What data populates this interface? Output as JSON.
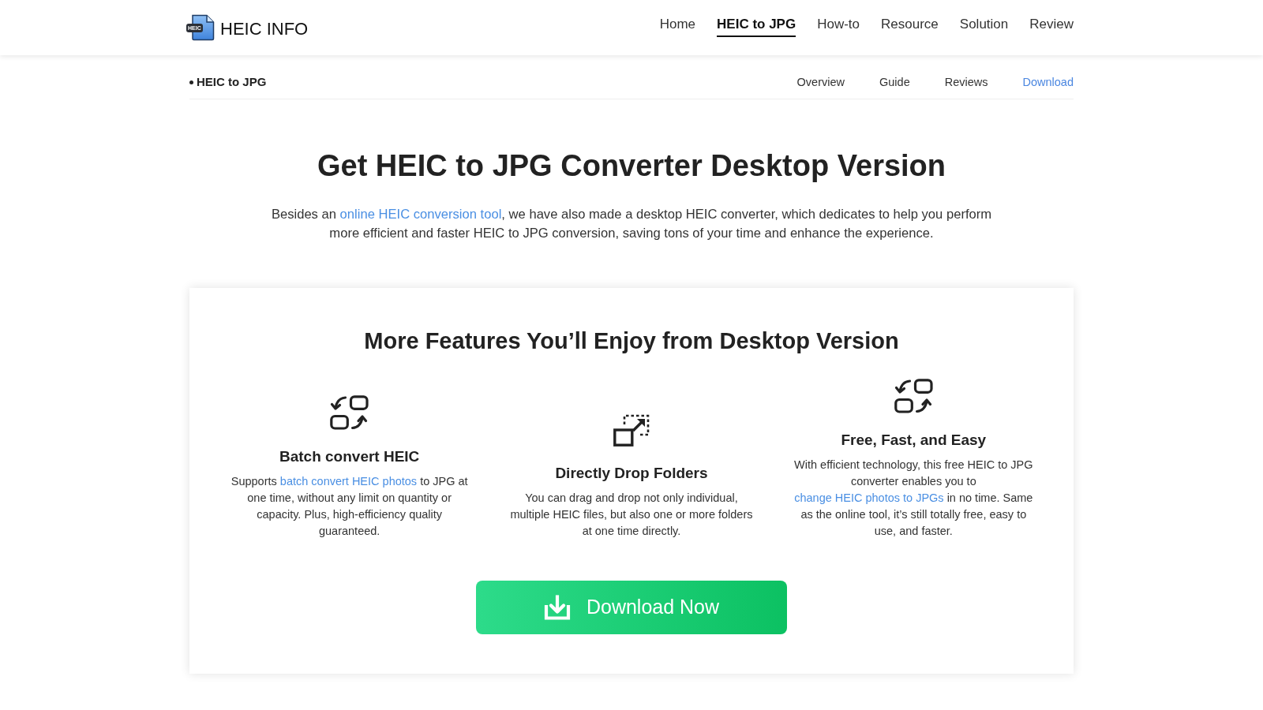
{
  "logo": {
    "badge": "HEIC",
    "name": "HEIC INFO"
  },
  "nav": [
    {
      "label": "Home",
      "selected": false
    },
    {
      "label": "HEIC to JPG",
      "selected": true
    },
    {
      "label": "How-to",
      "selected": false
    },
    {
      "label": "Resource",
      "selected": false
    },
    {
      "label": "Solution",
      "selected": false
    },
    {
      "label": "Review",
      "selected": false
    }
  ],
  "subnav": {
    "title": "HEIC to JPG",
    "links": [
      {
        "label": "Overview",
        "selected": false
      },
      {
        "label": "Guide",
        "selected": false
      },
      {
        "label": "Reviews",
        "selected": false
      },
      {
        "label": "Download",
        "selected": true
      }
    ]
  },
  "hero": {
    "title": "Get HEIC to JPG Converter Desktop Version",
    "text": [
      {
        "kind": "text",
        "text": "Besides an "
      },
      {
        "kind": "link",
        "text": "online HEIC conversion tool"
      },
      {
        "kind": "text",
        "text": ", we have also made a desktop HEIC converter, which dedicates to help you perform more efficient and faster HEIC to JPG conversion, saving tons of your time and enhance the experience."
      }
    ]
  },
  "features_card": {
    "title": "More Features You’ll Enjoy from Desktop Version",
    "features": [
      {
        "kind": "swap",
        "title": "Batch convert HEIC",
        "text": [
          {
            "kind": "text",
            "text": "Supports "
          },
          {
            "kind": "link",
            "text": "batch convert HEIC photos"
          },
          {
            "kind": "text",
            "text": " to JPG at one time, without any limit on quantity or capacity. Plus, high-efficiency quality guaranteed."
          }
        ]
      },
      {
        "kind": "drop",
        "title": "Directly Drop Folders",
        "text": [
          {
            "kind": "text",
            "text": "You can drag and drop not only individual, multiple HEIC files, but also one or more folders at one time directly."
          }
        ]
      },
      {
        "kind": "swap",
        "title": "Free, Fast, and Easy",
        "text": [
          {
            "kind": "text",
            "text": "With efficient technology, this free HEIC to JPG converter enables you to "
          },
          {
            "kind": "link",
            "text": "change HEIC photos to JPGs"
          },
          {
            "kind": "text",
            "text": " in no time. Same as the online tool, it’s still totally free, easy to use, and faster."
          }
        ]
      }
    ],
    "button": {
      "label": "Download Now"
    }
  }
}
